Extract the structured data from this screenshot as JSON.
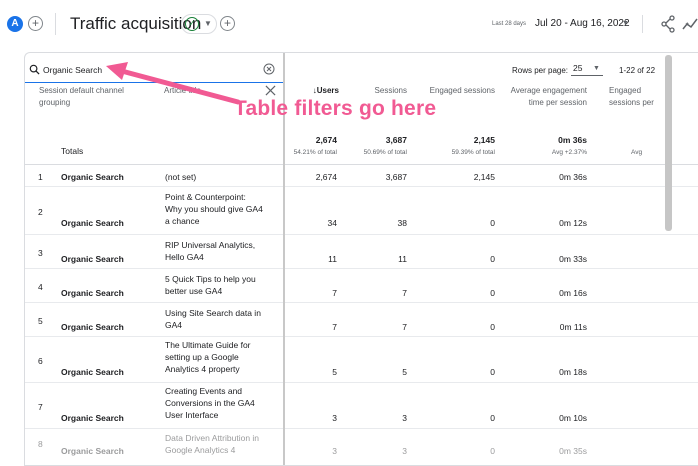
{
  "header": {
    "avatar": "A",
    "add_symbol": "+",
    "title": "Traffic acquisition",
    "date_label": "Last 28 days",
    "date_range": "Jul 20 - Aug 16, 2022"
  },
  "toolbar": {
    "search_value": "Organic Search",
    "rows_label": "Rows per page:",
    "rows_value": "25",
    "pager": "1-22 of 22"
  },
  "columns": {
    "dim1": "Session default channel grouping",
    "dim2": "Article title",
    "users": "↓Users",
    "sessions": "Sessions",
    "engaged": "Engaged sessions",
    "avg_time": "Average engagement time per session",
    "engaged_per": "Engaged sessions per"
  },
  "totals": {
    "label": "Totals",
    "users": "2,674",
    "users_sub": "54.21% of total",
    "sessions": "3,687",
    "sessions_sub": "50.69% of total",
    "engaged": "2,145",
    "engaged_sub": "59.39% of total",
    "avg_time": "0m 36s",
    "avg_time_sub": "Avg +2.37%",
    "engaged_per_sub": "Avg"
  },
  "rows": [
    {
      "idx": "1",
      "channel": "Organic Search",
      "title": "(not set)",
      "users": "2,674",
      "sessions": "3,687",
      "engaged": "2,145",
      "avg": "0m 36s"
    },
    {
      "idx": "2",
      "channel": "Organic Search",
      "title": "Point & Counterpoint: Why you should give GA4 a chance",
      "users": "34",
      "sessions": "38",
      "engaged": "0",
      "avg": "0m 12s"
    },
    {
      "idx": "3",
      "channel": "Organic Search",
      "title": "RIP Universal Analytics, Hello GA4",
      "users": "11",
      "sessions": "11",
      "engaged": "0",
      "avg": "0m 33s"
    },
    {
      "idx": "4",
      "channel": "Organic Search",
      "title": "5 Quick Tips to help you better use GA4",
      "users": "7",
      "sessions": "7",
      "engaged": "0",
      "avg": "0m 16s"
    },
    {
      "idx": "5",
      "channel": "Organic Search",
      "title": "Using Site Search data in GA4",
      "users": "7",
      "sessions": "7",
      "engaged": "0",
      "avg": "0m 11s"
    },
    {
      "idx": "6",
      "channel": "Organic Search",
      "title": "The Ultimate Guide for setting up a Google Analytics 4 property",
      "users": "5",
      "sessions": "5",
      "engaged": "0",
      "avg": "0m 18s"
    },
    {
      "idx": "7",
      "channel": "Organic Search",
      "title": "Creating Events and Conversions in the GA4 User Interface",
      "users": "3",
      "sessions": "3",
      "engaged": "0",
      "avg": "0m 10s"
    },
    {
      "idx": "8",
      "channel": "Organic Search",
      "title": "Data Driven Attribution in Google Analytics 4",
      "users": "3",
      "sessions": "3",
      "engaged": "0",
      "avg": "0m 35s"
    }
  ],
  "annotation": {
    "text": "Table filters go here",
    "color": "#f15a93"
  },
  "colors": {
    "accent": "#1a73e8",
    "check": "#188038"
  },
  "icons": [
    "plus-icon",
    "check-circle-icon",
    "chevron-down-icon",
    "share-icon",
    "insights-icon",
    "search-icon",
    "clear-icon",
    "close-icon"
  ]
}
